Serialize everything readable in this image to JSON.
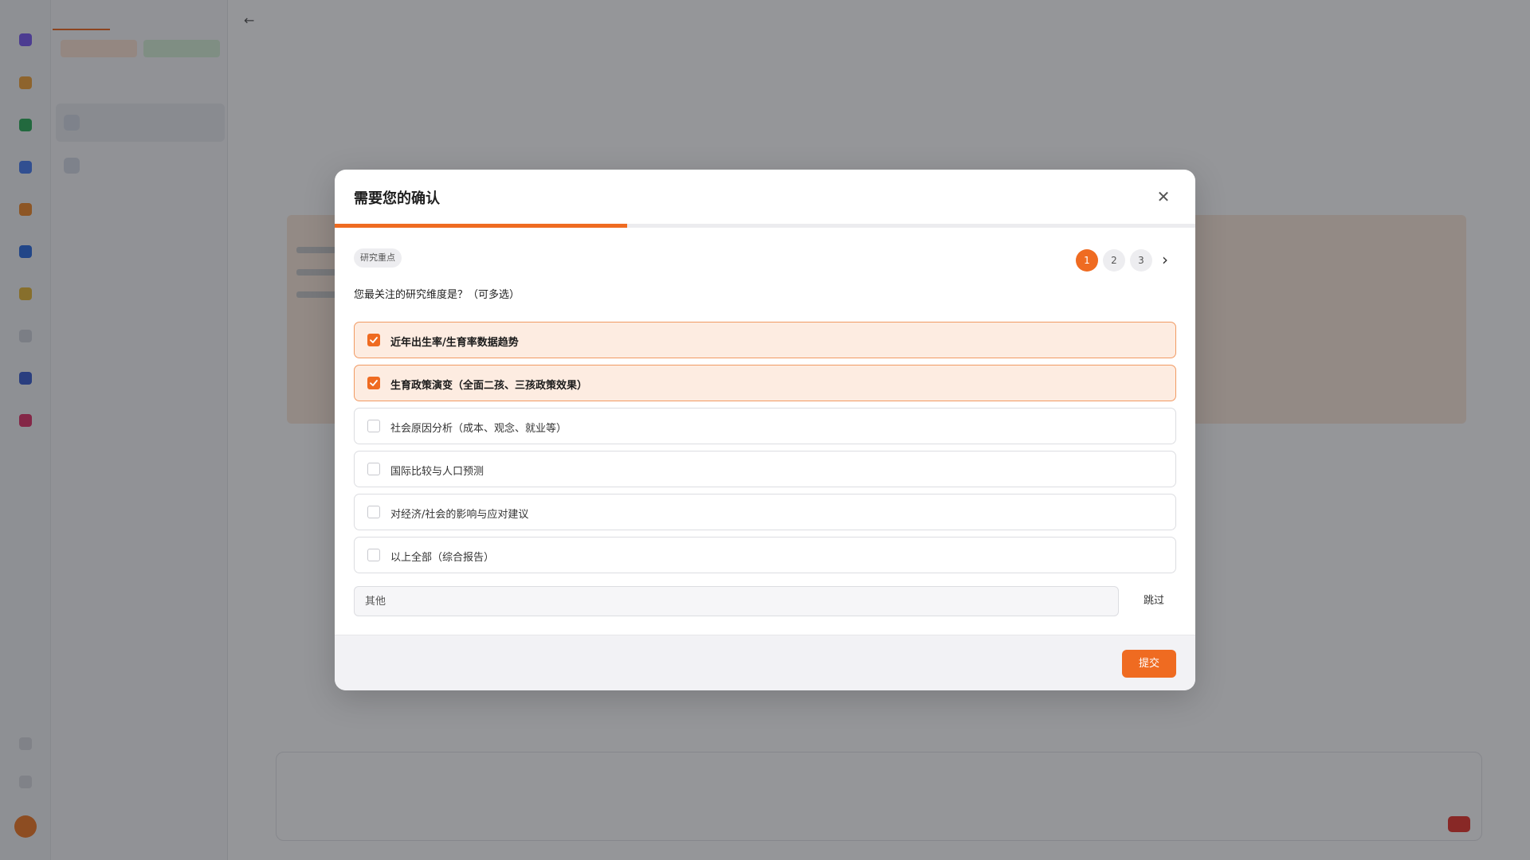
{
  "colors": {
    "accent": "#ef6b21",
    "option_checked_bg": "#fdece1",
    "option_checked_border": "#f19a63",
    "overlay": "rgba(20,22,28,0.45)"
  },
  "modal": {
    "title": "需要您的确认",
    "close_icon": "close-icon",
    "progress": 0.34,
    "tag": "研究重点",
    "steps": [
      "1",
      "2",
      "3"
    ],
    "active_step": "1",
    "next_icon": "chevron-right-icon",
    "question": "您最关注的研究维度是？（可多选）",
    "options": [
      {
        "label": "近年出生率/生育率数据趋势",
        "checked": true
      },
      {
        "label": "生育政策演变（全面二孩、三孩政策效果）",
        "checked": true
      },
      {
        "label": "社会原因分析（成本、观念、就业等）",
        "checked": false
      },
      {
        "label": "国际比较与人口预测",
        "checked": false
      },
      {
        "label": "对经济/社会的影响与应对建议",
        "checked": false
      },
      {
        "label": "以上全部（综合报告）",
        "checked": false
      }
    ],
    "other_placeholder": "其他",
    "other_value": "",
    "skip_label": "跳过",
    "submit_label": "提交"
  }
}
